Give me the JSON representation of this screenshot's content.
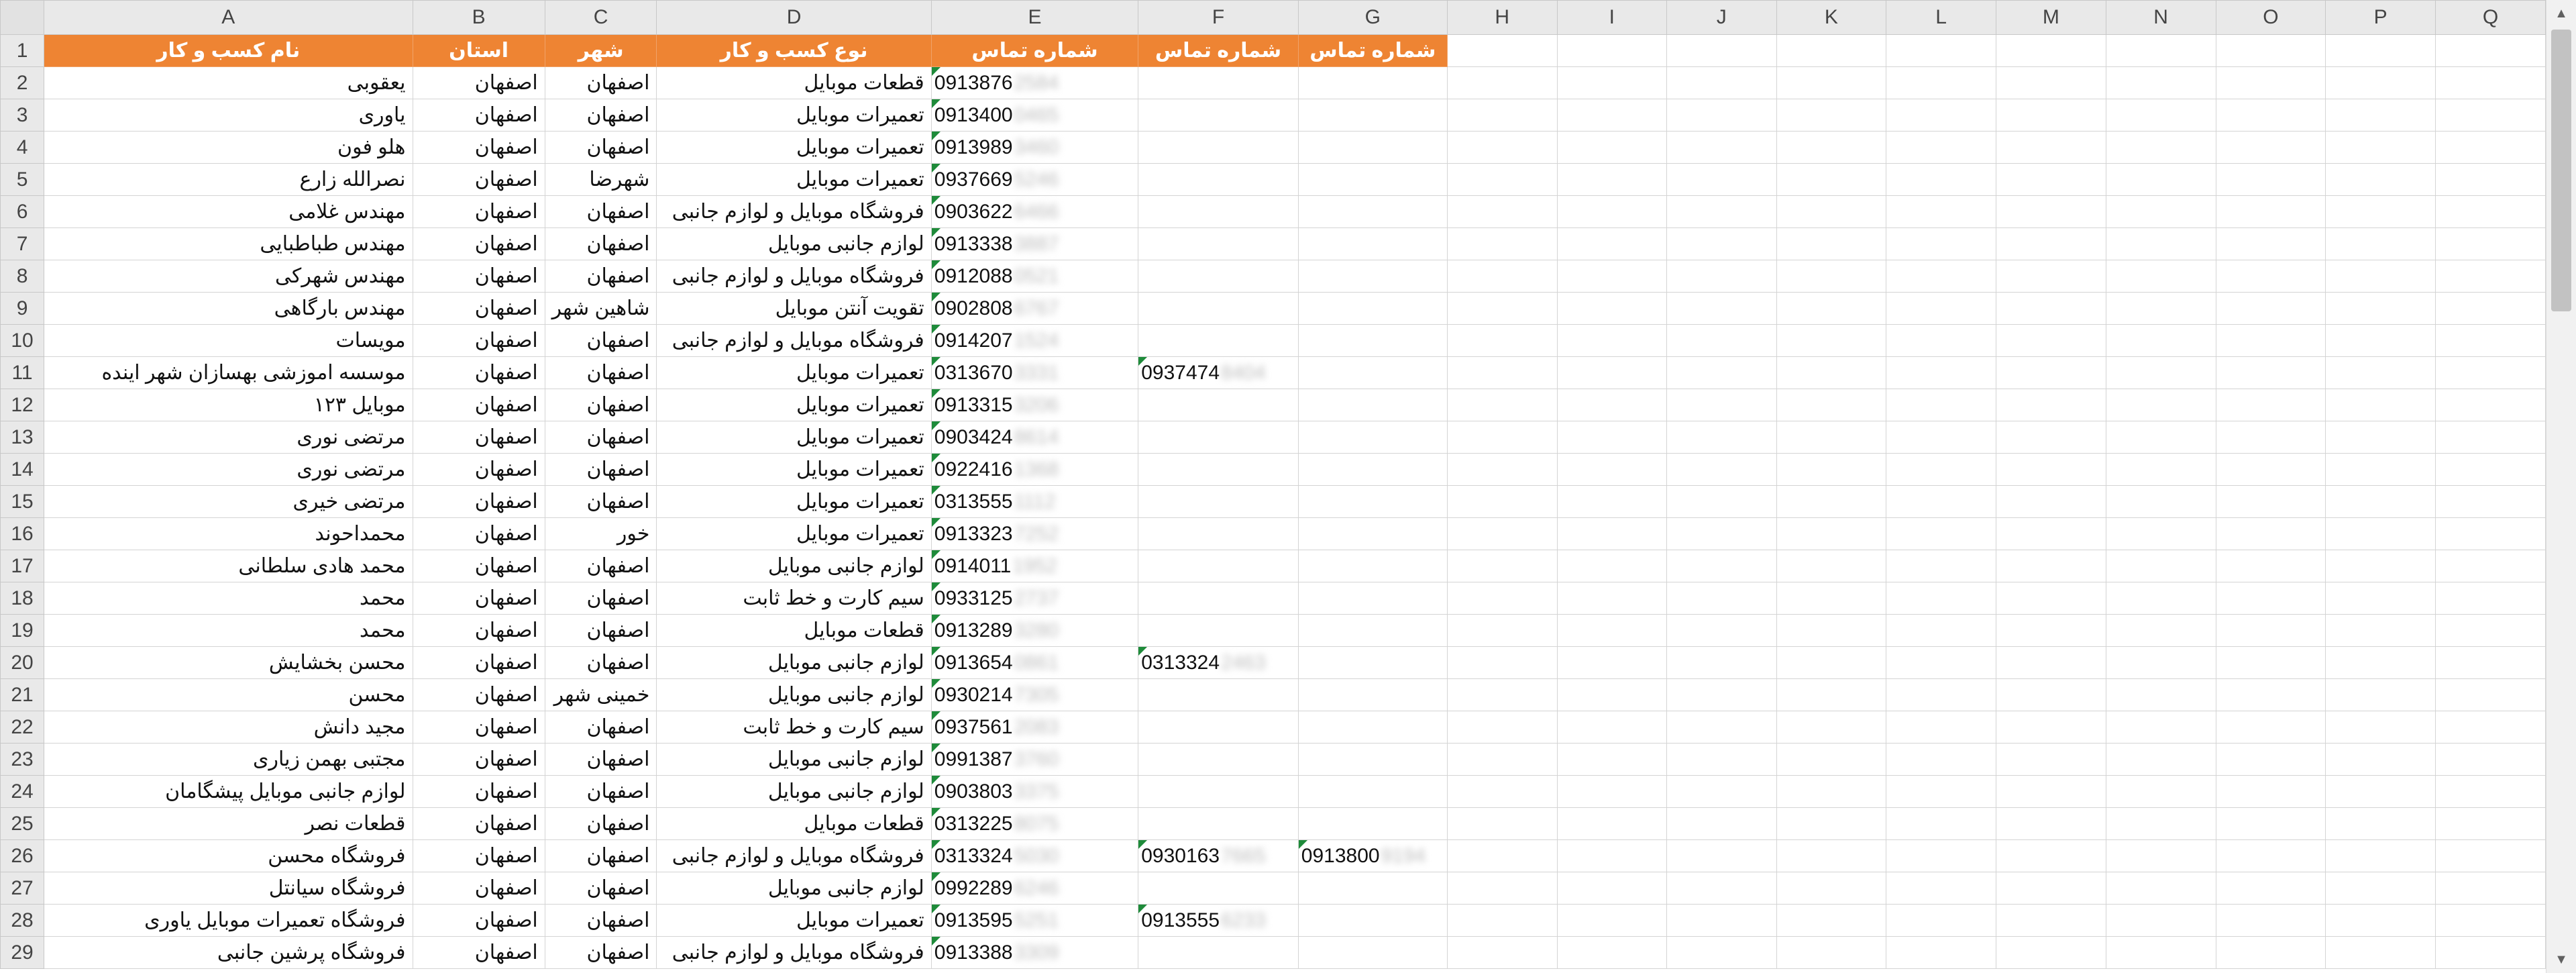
{
  "columns": [
    "A",
    "B",
    "C",
    "D",
    "E",
    "F",
    "G",
    "H",
    "I",
    "J",
    "K",
    "L",
    "M",
    "N",
    "O",
    "P",
    "Q"
  ],
  "header": [
    "نام کسب و کار",
    "استان",
    "شهر",
    "نوع کسب و کار",
    "شماره تماس",
    "شماره تماس",
    "شماره تماس"
  ],
  "rows": [
    {
      "n": "2",
      "name": "یعقوبی",
      "province": "اصفهان",
      "city": "اصفهان",
      "type": "قطعات موبایل",
      "phone1": "0913876",
      "phone1_hidden": "2584"
    },
    {
      "n": "3",
      "name": "یاوری",
      "province": "اصفهان",
      "city": "اصفهان",
      "type": "تعمیرات موبایل",
      "phone1": "0913400",
      "phone1_hidden": "0465"
    },
    {
      "n": "4",
      "name": "هلو فون",
      "province": "اصفهان",
      "city": "اصفهان",
      "type": "تعمیرات موبایل",
      "phone1": "0913989",
      "phone1_hidden": "3460"
    },
    {
      "n": "5",
      "name": "نصرالله زارع",
      "province": "اصفهان",
      "city": "شهرضا",
      "type": "تعمیرات موبایل",
      "phone1": "0937669",
      "phone1_hidden": "5246"
    },
    {
      "n": "6",
      "name": "مهندس غلامی",
      "province": "اصفهان",
      "city": "اصفهان",
      "type": "فروشگاه موبایل و لوازم جانبی",
      "phone1": "0903622",
      "phone1_hidden": "6466"
    },
    {
      "n": "7",
      "name": "مهندس طباطبایی",
      "province": "اصفهان",
      "city": "اصفهان",
      "type": "لوازم جانبی موبایل",
      "phone1": "0913338",
      "phone1_hidden": "3887"
    },
    {
      "n": "8",
      "name": "مهندس شهرکی",
      "province": "اصفهان",
      "city": "اصفهان",
      "type": "فروشگاه موبایل و لوازم جانبی",
      "phone1": "0912088",
      "phone1_hidden": "0521"
    },
    {
      "n": "9",
      "name": "مهندس بارگاهی",
      "province": "اصفهان",
      "city": "شاهین شهر",
      "type": "تقویت آنتن موبایل",
      "phone1": "0902808",
      "phone1_hidden": "6767"
    },
    {
      "n": "10",
      "name": "مویسات",
      "province": "اصفهان",
      "city": "اصفهان",
      "type": "فروشگاه موبایل و لوازم جانبی",
      "phone1": "0914207",
      "phone1_hidden": "1524"
    },
    {
      "n": "11",
      "name": "موسسه اموزشی بهسازان شهر اینده",
      "province": "اصفهان",
      "city": "اصفهان",
      "type": "تعمیرات موبایل",
      "phone1": "0313670",
      "phone1_hidden": "3331",
      "phone2": "0937474",
      "phone2_hidden": "8404"
    },
    {
      "n": "12",
      "name": "موبایل ۱۲۳",
      "province": "اصفهان",
      "city": "اصفهان",
      "type": "تعمیرات موبایل",
      "phone1": "0913315",
      "phone1_hidden": "3206"
    },
    {
      "n": "13",
      "name": "مرتضی نوری",
      "province": "اصفهان",
      "city": "اصفهان",
      "type": "تعمیرات موبایل",
      "phone1": "0903424",
      "phone1_hidden": "8614"
    },
    {
      "n": "14",
      "name": "مرتضی نوری",
      "province": "اصفهان",
      "city": "اصفهان",
      "type": "تعمیرات موبایل",
      "phone1": "0922416",
      "phone1_hidden": "1368"
    },
    {
      "n": "15",
      "name": "مرتضی خیری",
      "province": "اصفهان",
      "city": "اصفهان",
      "type": "تعمیرات موبایل",
      "phone1": "0313555",
      "phone1_hidden": "1112"
    },
    {
      "n": "16",
      "name": "محمداحوند",
      "province": "اصفهان",
      "city": "خور",
      "type": "تعمیرات موبایل",
      "phone1": "0913323",
      "phone1_hidden": "7252"
    },
    {
      "n": "17",
      "name": "محمد هادی سلطانی",
      "province": "اصفهان",
      "city": "اصفهان",
      "type": "لوازم جانبی موبایل",
      "phone1": "0914011",
      "phone1_hidden": "1952"
    },
    {
      "n": "18",
      "name": "محمد",
      "province": "اصفهان",
      "city": "اصفهان",
      "type": "سیم کارت و خط ثابت",
      "phone1": "0933125",
      "phone1_hidden": "2737"
    },
    {
      "n": "19",
      "name": "محمد",
      "province": "اصفهان",
      "city": "اصفهان",
      "type": "قطعات موبایل",
      "phone1": "0913289",
      "phone1_hidden": "3280"
    },
    {
      "n": "20",
      "name": "محسن بخشایش",
      "province": "اصفهان",
      "city": "اصفهان",
      "type": "لوازم جانبی موبایل",
      "phone1": "0913654",
      "phone1_hidden": "0861",
      "phone2": "0313324",
      "phone2_hidden": "2463"
    },
    {
      "n": "21",
      "name": "محسن",
      "province": "اصفهان",
      "city": "خمینی شهر",
      "type": "لوازم جانبی موبایل",
      "phone1": "0930214",
      "phone1_hidden": "7305"
    },
    {
      "n": "22",
      "name": "مجید دانش",
      "province": "اصفهان",
      "city": "اصفهان",
      "type": "سیم کارت و خط ثابت",
      "phone1": "0937561",
      "phone1_hidden": "2083"
    },
    {
      "n": "23",
      "name": "مجتبی بهمن زیاری",
      "province": "اصفهان",
      "city": "اصفهان",
      "type": "لوازم جانبی موبایل",
      "phone1": "0991387",
      "phone1_hidden": "3760"
    },
    {
      "n": "24",
      "name": "لوازم جانبی موبایل پیشگامان",
      "province": "اصفهان",
      "city": "اصفهان",
      "type": "لوازم جانبی موبایل",
      "phone1": "0903803",
      "phone1_hidden": "3375"
    },
    {
      "n": "25",
      "name": "قطعات نصر",
      "province": "اصفهان",
      "city": "اصفهان",
      "type": "قطعات موبایل",
      "phone1": "0313225",
      "phone1_hidden": "8075"
    },
    {
      "n": "26",
      "name": "فروشگاه محسن",
      "province": "اصفهان",
      "city": "اصفهان",
      "type": "فروشگاه موبایل و لوازم جانبی",
      "phone1": "0313324",
      "phone1_hidden": "5030",
      "phone2": "0930163",
      "phone2_hidden": "7665",
      "phone3": "0913800",
      "phone3_hidden": "9194"
    },
    {
      "n": "27",
      "name": "فروشگاه سیانتل",
      "province": "اصفهان",
      "city": "اصفهان",
      "type": "لوازم جانبی موبایل",
      "phone1": "0992289",
      "phone1_hidden": "6246"
    },
    {
      "n": "28",
      "name": "فروشگاه تعمیرات موبایل یاوری",
      "province": "اصفهان",
      "city": "اصفهان",
      "type": "تعمیرات موبایل",
      "phone1": "0913595",
      "phone1_hidden": "5251",
      "phone2": "0913555",
      "phone2_hidden": "6233"
    },
    {
      "n": "29",
      "name": "فروشگاه پرشین جانبی",
      "province": "اصفهان",
      "city": "اصفهان",
      "type": "فروشگاه موبایل و لوازم جانبی",
      "phone1": "0913388",
      "phone1_hidden": "3309"
    }
  ],
  "scrollbar": {
    "up_icon": "▲",
    "down_icon": "▼"
  }
}
